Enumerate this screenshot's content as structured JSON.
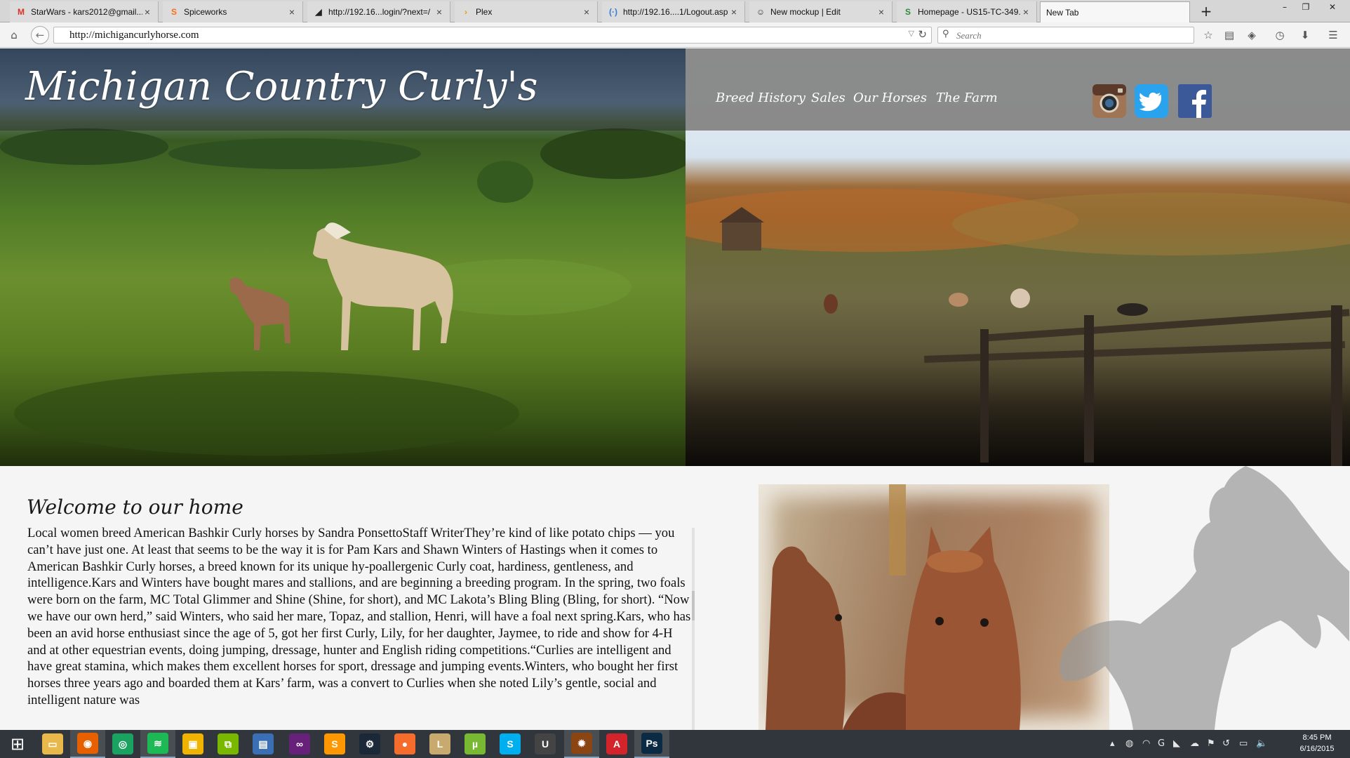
{
  "browser": {
    "tabs": [
      {
        "title": "StarWars - kars2012@gmail....",
        "icon": "gmail-icon",
        "glyph": "M",
        "color": "#d93025"
      },
      {
        "title": "Spiceworks",
        "icon": "spiceworks-icon",
        "glyph": "S",
        "color": "#ff6a13"
      },
      {
        "title": "http://192.16...login/?next=/",
        "icon": "router-icon",
        "glyph": "◢",
        "color": "#222222"
      },
      {
        "title": "Plex",
        "icon": "plex-icon",
        "glyph": "›",
        "color": "#e5a00d"
      },
      {
        "title": "http://192.16....1/Logout.asp",
        "icon": "network-icon",
        "glyph": "(·)",
        "color": "#3a7bd5"
      },
      {
        "title": "New mockup | Edit",
        "icon": "smiley-icon",
        "glyph": "☺",
        "color": "#333333"
      },
      {
        "title": "Homepage - US15-TC-349....",
        "icon": "sharepoint-icon",
        "glyph": "S",
        "color": "#2a8c3a"
      },
      {
        "title": "New Tab",
        "icon": "",
        "glyph": "",
        "color": "#333333"
      }
    ],
    "new_tab": "+",
    "window_controls": {
      "minimize": "–",
      "restore": "❐",
      "close": "✕"
    },
    "url": "http://michigancurlyhorse.com",
    "search_placeholder": "Search"
  },
  "site": {
    "title": "Michigan Country Curly's",
    "nav": [
      "Breed History",
      "Sales",
      "Our Horses",
      "The Farm"
    ],
    "social": [
      "instagram-icon",
      "twitter-icon",
      "facebook-icon"
    ],
    "welcome_heading": "Welcome to our home",
    "article": "Local women breed American Bashkir Curly horses by Sandra PonsettoStaff WriterThey’re kind of like potato chips — you can’t have just one. At least that seems to be the way it is for Pam Kars and Shawn Winters of Hastings when it comes to American Bashkir Curly horses, a breed known for its unique hy-poallergenic Curly coat, hardiness, gentleness, and intelligence.Kars and Winters have bought mares and stallions, and are beginning a breeding program. In the spring, two foals were born on the farm, MC Total Glimmer and Shine (Shine, for short), and MC Lakota’s Bling Bling (Bling, for short). “Now we have our own herd,” said Winters, who said her mare, Topaz, and stallion, Henri, will have a foal next spring.Kars, who has been an avid horse enthusiast since the age of 5, got her first Curly, Lily, for her daughter, Jaymee, to ride and show for 4-H and at other equestrian events, doing jumping, dressage, hunter and English riding competitions.“Curlies are intelligent and have great stamina, which makes them excellent horses for sport, dressage and jumping events.Winters, who bought her first horses three years ago and boarded them at Kars’ farm, was a convert to Curlies when she noted Lily’s gentle, social and intelligent nature was"
  },
  "taskbar": {
    "apps": [
      {
        "name": "start-button",
        "glyph": "⊞",
        "color": "transparent"
      },
      {
        "name": "file-explorer-icon",
        "glyph": "▭",
        "color": "#e8b84a"
      },
      {
        "name": "firefox-icon",
        "glyph": "◉",
        "color": "#e66000"
      },
      {
        "name": "chrome-icon",
        "glyph": "◎",
        "color": "#1aa260"
      },
      {
        "name": "spotify-icon",
        "glyph": "≋",
        "color": "#1db954"
      },
      {
        "name": "sticky-app-icon",
        "glyph": "▣",
        "color": "#f0b400"
      },
      {
        "name": "vmware-icon",
        "glyph": "⧉",
        "color": "#7ab800"
      },
      {
        "name": "remote-desktop-icon",
        "glyph": "▤",
        "color": "#3a6fb5"
      },
      {
        "name": "visual-studio-icon",
        "glyph": "∞",
        "color": "#68217a"
      },
      {
        "name": "sublime-text-icon",
        "glyph": "S",
        "color": "#ff9800"
      },
      {
        "name": "steam-icon",
        "glyph": "⚙",
        "color": "#1b2838"
      },
      {
        "name": "origin-icon",
        "glyph": "●",
        "color": "#f56c2d"
      },
      {
        "name": "league-of-legends-icon",
        "glyph": "L",
        "color": "#c8aa6e"
      },
      {
        "name": "utorrent-icon",
        "glyph": "µ",
        "color": "#78b833"
      },
      {
        "name": "skype-icon",
        "glyph": "S",
        "color": "#00aff0"
      },
      {
        "name": "ue-launcher-icon",
        "glyph": "U",
        "color": "#444444"
      },
      {
        "name": "game-launcher-icon",
        "glyph": "✹",
        "color": "#8b4513"
      },
      {
        "name": "acrobat-icon",
        "glyph": "A",
        "color": "#d3242b"
      },
      {
        "name": "photoshop-icon",
        "glyph": "Ps",
        "color": "#0b2a44"
      }
    ],
    "time": "8:45 PM",
    "date": "6/16/2015"
  }
}
